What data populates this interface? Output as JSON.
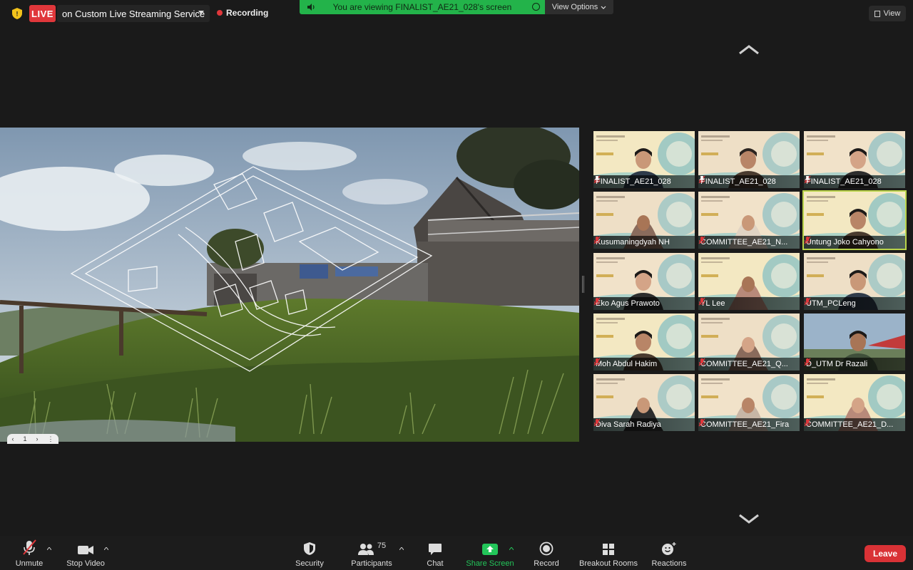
{
  "topbar": {
    "live_badge": "LIVE",
    "stream_service": "on Custom Live Streaming Service",
    "recording_label": "Recording",
    "share_banner": "You are viewing FINALIST_AE21_028's screen",
    "view_options_label": "View Options",
    "view_label": "View"
  },
  "shared_screen": {
    "page_number": "1"
  },
  "participants": [
    {
      "name": "FINALIST_AE21_028",
      "pinned": true
    },
    {
      "name": "FINALIST_AE21_028",
      "pinned": true
    },
    {
      "name": "FINALIST_AE21_028",
      "pinned": true
    },
    {
      "name": "Kusumaningdyah NH",
      "pinned": false
    },
    {
      "name": "COMMITTEE_AE21_N...",
      "pinned": false
    },
    {
      "name": "Untung Joko Cahyono",
      "pinned": false,
      "active": true
    },
    {
      "name": "Eko Agus Prawoto",
      "pinned": false
    },
    {
      "name": "YL Lee",
      "pinned": false
    },
    {
      "name": "UTM_PCLeng",
      "pinned": false
    },
    {
      "name": "Moh Abdul Hakim",
      "pinned": false
    },
    {
      "name": "COMMITTEE_AE21_Q...",
      "pinned": false
    },
    {
      "name": "D_UTM Dr Razali",
      "pinned": false
    },
    {
      "name": "Diva Sarah Radiya",
      "pinned": false
    },
    {
      "name": "COMMITTEE_AE21_Fira",
      "pinned": false
    },
    {
      "name": "COMMITTEE_AE21_D...",
      "pinned": false
    }
  ],
  "toolbar": {
    "unmute": "Unmute",
    "stop_video": "Stop Video",
    "security": "Security",
    "participants": "Participants",
    "participant_count": "75",
    "chat": "Chat",
    "share_screen": "Share Screen",
    "record": "Record",
    "breakout_rooms": "Breakout Rooms",
    "reactions": "Reactions",
    "leave": "Leave"
  },
  "colors": {
    "live_red": "#e0373b",
    "share_green": "#23b34a",
    "active_speaker": "#b9d34a",
    "leave_red": "#d93236"
  }
}
